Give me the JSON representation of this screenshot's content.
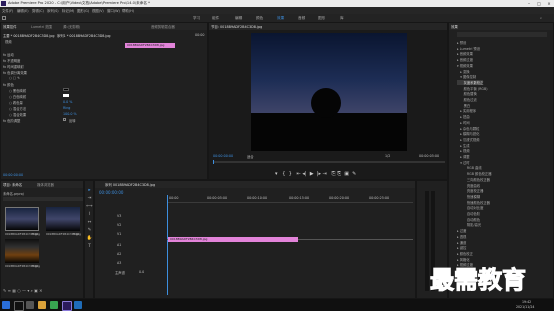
{
  "window": {
    "title": "Adobe Premiere Pro 2020 - C:\\用户\\Video\\文档\\Adobe\\Premiere Pro\\14.0\\未命名 *"
  },
  "menu": [
    "文件(F)",
    "编辑(E)",
    "剪辑(C)",
    "序列(S)",
    "标记(M)",
    "图形(G)",
    "视图(V)",
    "窗口(W)",
    "帮助(H)"
  ],
  "workspaces": [
    "学习",
    "组件",
    "编辑",
    "颜色",
    "效果",
    "音频",
    "图形",
    "库"
  ],
  "active_workspace": "效果",
  "effect_controls": {
    "tabs": [
      "效果控件",
      "Lumetri 范围",
      "源:(无剪辑)",
      "音频剪辑混合器"
    ],
    "clip": "主要 * 0018B9ADF2B4C3D8.jpg",
    "sequence": "序列1 * 0018B9ADF2B4C3D8.jpg",
    "section": "视频",
    "timecode_right": "00:00",
    "clip_bar": "0018B9ADF2B4C3D8.jpg",
    "rows": [
      "fx 运动",
      "fx 不透明度",
      "fx 时间重映射",
      "fx 色调分离效果",
      "○ □ ✎",
      "fx 颜色",
      "○ 黑色映射",
      "○ 白色映射",
      "○ 着色量",
      "○ 混合方法",
      "　",
      "○ 混合效果",
      "fx 色阶调整"
    ],
    "values": [
      "0.0 %",
      "Ring",
      "100.0 %"
    ],
    "checkbox_label": "反转",
    "bottom_timecode": "00:00:00:00"
  },
  "program_monitor": {
    "title": "节目: 0018B9ADF2B4C3D8.jpg",
    "tc_left": "00:00:00:00",
    "fit": "适合",
    "fraction": "1/2",
    "tc_right": "00:00:05:00"
  },
  "project": {
    "tabs": [
      "项目: 未命名",
      "媒体浏览器"
    ],
    "file": "未命名.prproj",
    "items": [
      {
        "name": "0018B9ADF2B4C3D8.jpg",
        "dur": "5:00"
      },
      {
        "name": "0018B9ADF2B4C3D8.jpg",
        "dur": "5:00"
      },
      {
        "name": "0018B9ADF2B4C3D8.jpg",
        "dur": "5:00"
      }
    ]
  },
  "timeline": {
    "tab": "序列 0018B9ADF2B4C3D8.jpg",
    "timecode": "00:00:00:00",
    "ruler": [
      "00:00",
      "00:00:05:00",
      "00:00:10:00",
      "00:00:15:00",
      "00:00:20:00",
      "00:00:25:00"
    ],
    "tracks": [
      "V3",
      "V2",
      "V1",
      "A1",
      "A2",
      "A3"
    ],
    "master": "主声道",
    "master_val": "0.0",
    "clip": "0018B9ADF2B4C3D8.jpg"
  },
  "effects": {
    "title": "效果",
    "tree": [
      "▸ 预设",
      "▸ Lumetri 预设",
      "▸ 音频效果",
      "▸ 音频过渡",
      "▾ 视频效果",
      "　▸ 变换",
      "　▾ 图像控制",
      "　　灰度系数校正",
      "　　颜色平衡 (RGB)",
      "　　颜色替换",
      "　　颜色过滤",
      "　　黑白",
      "　▸ 实用程序",
      "　▸ 扭曲",
      "　▸ 时间",
      "　▸ 杂色与颗粒",
      "　▸ 模糊与锐化",
      "　▸ 沉浸式视频",
      "　▸ 生成",
      "　▸ 视频",
      "　▸ 调整",
      "　▾ 过时",
      "　　　RGB 曲线",
      "　　　RGB 颜色校正器",
      "　　　三向颜色校正器",
      "　　　亮度曲线",
      "　　　亮度校正器",
      "　　　快速模糊",
      "　　　快速颜色校正器",
      "　　　自动对比度",
      "　　　自动色阶",
      "　　　自动颜色",
      "　　　阴影/高光",
      "▸ 过渡",
      "▸ 透视",
      "▸ 通道",
      "▸ 键控",
      "▸ 颜色校正",
      "▸ 风格化",
      "▸ 视频过渡"
    ]
  },
  "taskbar": {
    "time": "19:42",
    "date": "2021/11/24"
  },
  "watermark": "最需教育"
}
